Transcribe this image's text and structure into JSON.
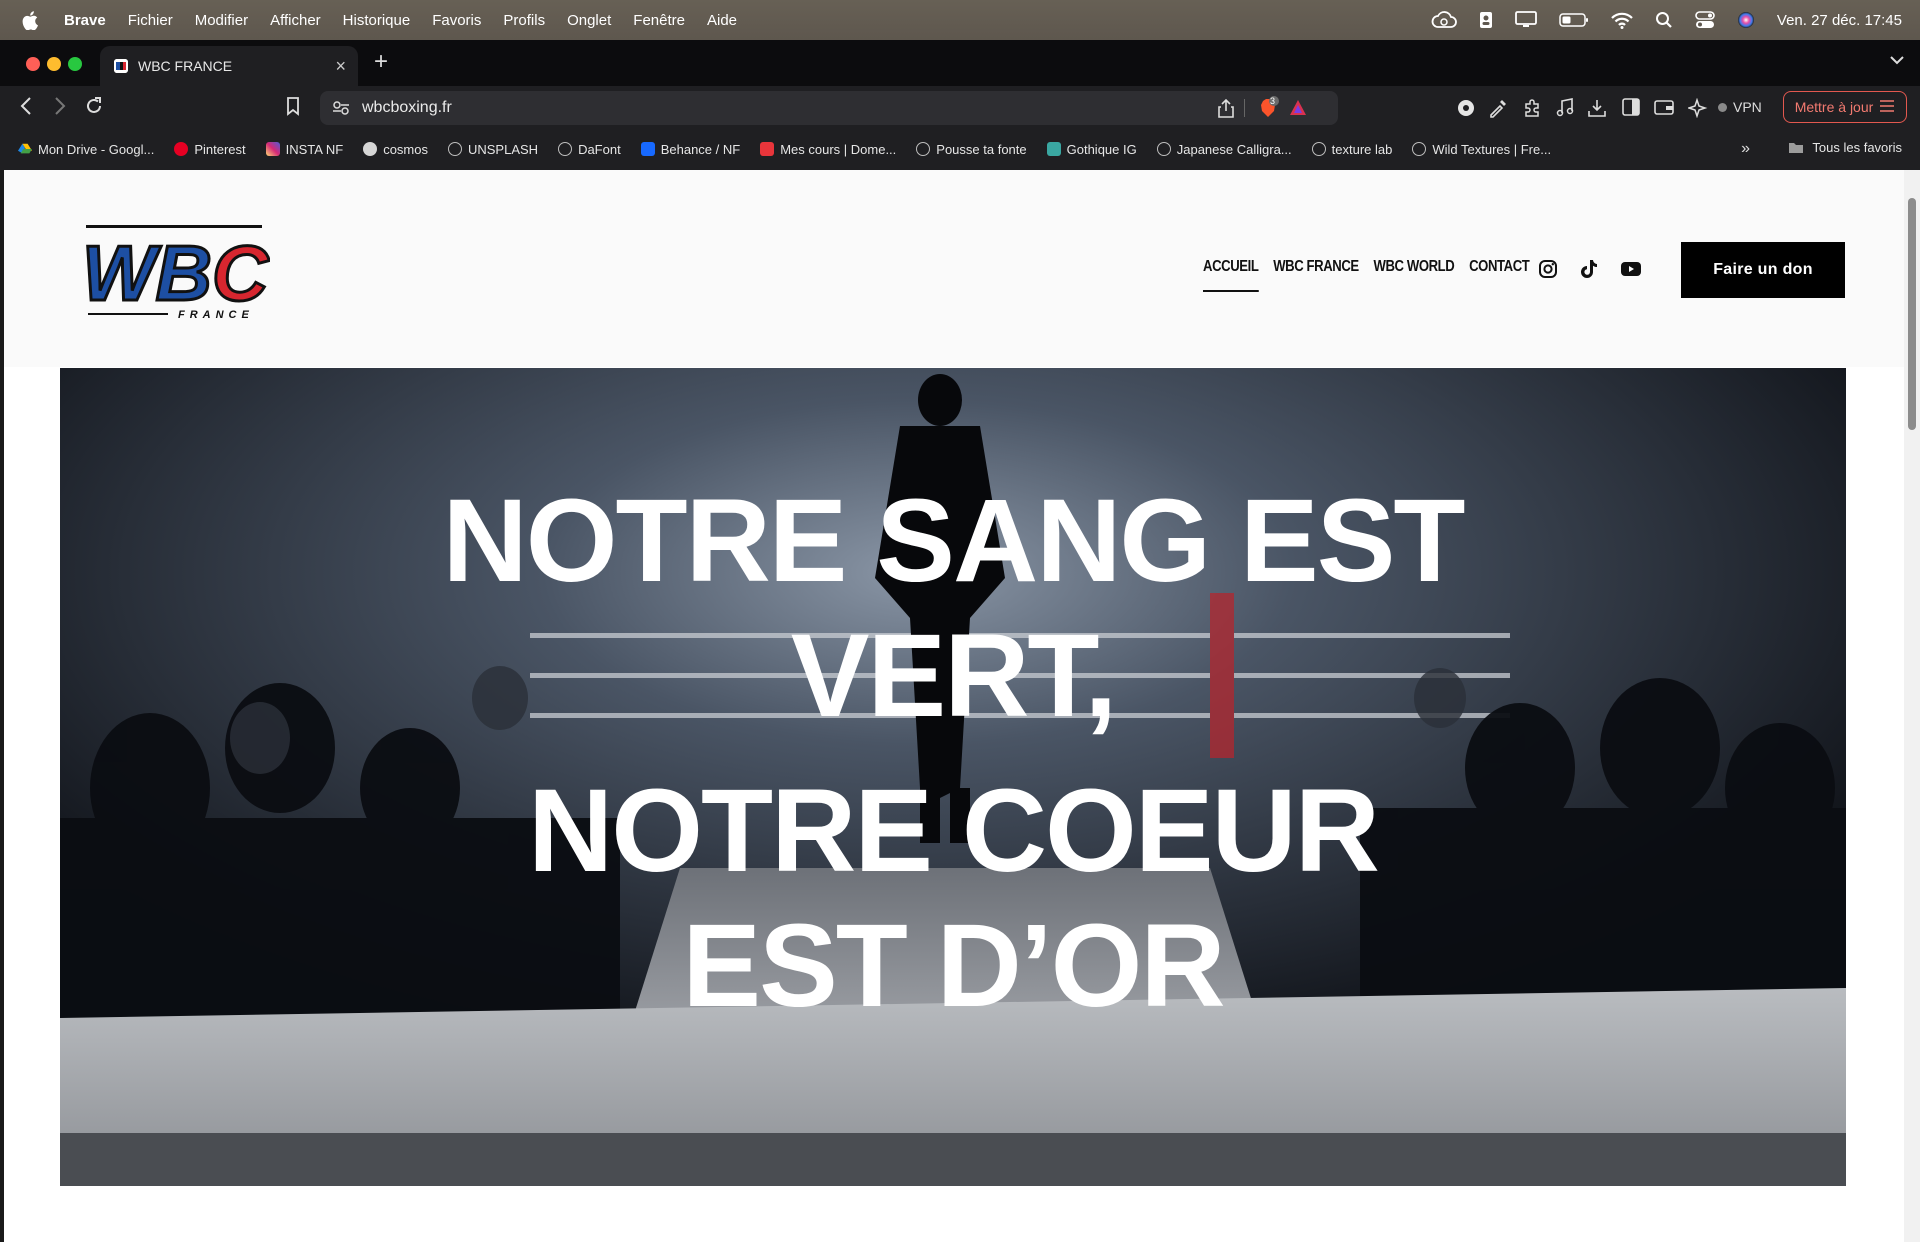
{
  "menubar": {
    "app": "Brave",
    "items": [
      "Fichier",
      "Modifier",
      "Afficher",
      "Historique",
      "Favoris",
      "Profils",
      "Onglet",
      "Fenêtre",
      "Aide"
    ],
    "clock": "Ven. 27 déc.  17:45",
    "status_icons": [
      "cloud-icon",
      "contacts-icon",
      "display-icon",
      "battery-icon",
      "wifi-icon",
      "spotlight-icon",
      "control-center-icon",
      "siri-icon"
    ]
  },
  "browser": {
    "tab_title": "WBC FRANCE",
    "url": "wbcboxing.fr",
    "brave_badge": "3",
    "vpn_label": "VPN",
    "update_label": "Mettre à jour",
    "bookmarks": [
      {
        "label": "Mon Drive - Googl...",
        "icon": "google-drive-icon",
        "color": "#2ea04a"
      },
      {
        "label": "Pinterest",
        "icon": "pinterest-icon",
        "color": "#e60023"
      },
      {
        "label": "INSTA NF",
        "icon": "instagram-icon",
        "color": "#d6249f"
      },
      {
        "label": "cosmos",
        "icon": "cosmos-icon",
        "color": "#cfcfcf"
      },
      {
        "label": "UNSPLASH",
        "icon": "globe-icon",
        "color": "#9a9a9a"
      },
      {
        "label": "DaFont",
        "icon": "globe-icon",
        "color": "#9a9a9a"
      },
      {
        "label": "Behance / NF",
        "icon": "behance-icon",
        "color": "#1769ff"
      },
      {
        "label": "Mes cours | Dome...",
        "icon": "domestika-icon",
        "color": "#e8353b"
      },
      {
        "label": "Pousse ta fonte",
        "icon": "globe-icon",
        "color": "#9a9a9a"
      },
      {
        "label": "Gothique IG",
        "icon": "gothique-icon",
        "color": "#3aa7a2"
      },
      {
        "label": "Japanese Calligra...",
        "icon": "globe-icon",
        "color": "#9a9a9a"
      },
      {
        "label": "texture lab",
        "icon": "globe-icon",
        "color": "#9a9a9a"
      },
      {
        "label": "Wild Textures | Fre...",
        "icon": "globe-icon",
        "color": "#9a9a9a"
      }
    ],
    "all_bookmarks_label": "Tous les favoris"
  },
  "site": {
    "logo_text": "WBC",
    "logo_sub": "FRANCE",
    "nav": [
      "ACCUEIL",
      "WBC FRANCE",
      "WBC WORLD",
      "CONTACT"
    ],
    "social": [
      "instagram-icon",
      "tiktok-icon",
      "youtube-icon"
    ],
    "donate_label": "Faire un don",
    "hero": {
      "line1": "NOTRE SANG EST",
      "line2": "VERT,",
      "line3": "NOTRE COEUR",
      "line4": "EST D’OR"
    }
  },
  "colors": {
    "logo_blue": "#1d4fa3",
    "logo_red": "#d7262f",
    "update_red": "#e2584f"
  }
}
